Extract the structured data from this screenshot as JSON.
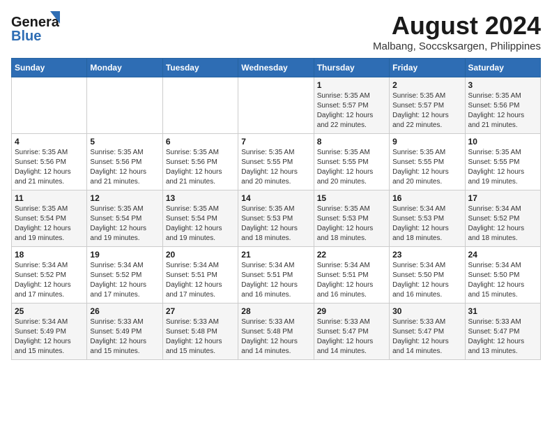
{
  "logo": {
    "line1": "General",
    "line2": "Blue"
  },
  "title": "August 2024",
  "location": "Malbang, Soccsksargen, Philippines",
  "weekdays": [
    "Sunday",
    "Monday",
    "Tuesday",
    "Wednesday",
    "Thursday",
    "Friday",
    "Saturday"
  ],
  "weeks": [
    [
      {
        "day": "",
        "info": ""
      },
      {
        "day": "",
        "info": ""
      },
      {
        "day": "",
        "info": ""
      },
      {
        "day": "",
        "info": ""
      },
      {
        "day": "1",
        "info": "Sunrise: 5:35 AM\nSunset: 5:57 PM\nDaylight: 12 hours\nand 22 minutes."
      },
      {
        "day": "2",
        "info": "Sunrise: 5:35 AM\nSunset: 5:57 PM\nDaylight: 12 hours\nand 22 minutes."
      },
      {
        "day": "3",
        "info": "Sunrise: 5:35 AM\nSunset: 5:56 PM\nDaylight: 12 hours\nand 21 minutes."
      }
    ],
    [
      {
        "day": "4",
        "info": "Sunrise: 5:35 AM\nSunset: 5:56 PM\nDaylight: 12 hours\nand 21 minutes."
      },
      {
        "day": "5",
        "info": "Sunrise: 5:35 AM\nSunset: 5:56 PM\nDaylight: 12 hours\nand 21 minutes."
      },
      {
        "day": "6",
        "info": "Sunrise: 5:35 AM\nSunset: 5:56 PM\nDaylight: 12 hours\nand 21 minutes."
      },
      {
        "day": "7",
        "info": "Sunrise: 5:35 AM\nSunset: 5:55 PM\nDaylight: 12 hours\nand 20 minutes."
      },
      {
        "day": "8",
        "info": "Sunrise: 5:35 AM\nSunset: 5:55 PM\nDaylight: 12 hours\nand 20 minutes."
      },
      {
        "day": "9",
        "info": "Sunrise: 5:35 AM\nSunset: 5:55 PM\nDaylight: 12 hours\nand 20 minutes."
      },
      {
        "day": "10",
        "info": "Sunrise: 5:35 AM\nSunset: 5:55 PM\nDaylight: 12 hours\nand 19 minutes."
      }
    ],
    [
      {
        "day": "11",
        "info": "Sunrise: 5:35 AM\nSunset: 5:54 PM\nDaylight: 12 hours\nand 19 minutes."
      },
      {
        "day": "12",
        "info": "Sunrise: 5:35 AM\nSunset: 5:54 PM\nDaylight: 12 hours\nand 19 minutes."
      },
      {
        "day": "13",
        "info": "Sunrise: 5:35 AM\nSunset: 5:54 PM\nDaylight: 12 hours\nand 19 minutes."
      },
      {
        "day": "14",
        "info": "Sunrise: 5:35 AM\nSunset: 5:53 PM\nDaylight: 12 hours\nand 18 minutes."
      },
      {
        "day": "15",
        "info": "Sunrise: 5:35 AM\nSunset: 5:53 PM\nDaylight: 12 hours\nand 18 minutes."
      },
      {
        "day": "16",
        "info": "Sunrise: 5:34 AM\nSunset: 5:53 PM\nDaylight: 12 hours\nand 18 minutes."
      },
      {
        "day": "17",
        "info": "Sunrise: 5:34 AM\nSunset: 5:52 PM\nDaylight: 12 hours\nand 18 minutes."
      }
    ],
    [
      {
        "day": "18",
        "info": "Sunrise: 5:34 AM\nSunset: 5:52 PM\nDaylight: 12 hours\nand 17 minutes."
      },
      {
        "day": "19",
        "info": "Sunrise: 5:34 AM\nSunset: 5:52 PM\nDaylight: 12 hours\nand 17 minutes."
      },
      {
        "day": "20",
        "info": "Sunrise: 5:34 AM\nSunset: 5:51 PM\nDaylight: 12 hours\nand 17 minutes."
      },
      {
        "day": "21",
        "info": "Sunrise: 5:34 AM\nSunset: 5:51 PM\nDaylight: 12 hours\nand 16 minutes."
      },
      {
        "day": "22",
        "info": "Sunrise: 5:34 AM\nSunset: 5:51 PM\nDaylight: 12 hours\nand 16 minutes."
      },
      {
        "day": "23",
        "info": "Sunrise: 5:34 AM\nSunset: 5:50 PM\nDaylight: 12 hours\nand 16 minutes."
      },
      {
        "day": "24",
        "info": "Sunrise: 5:34 AM\nSunset: 5:50 PM\nDaylight: 12 hours\nand 15 minutes."
      }
    ],
    [
      {
        "day": "25",
        "info": "Sunrise: 5:34 AM\nSunset: 5:49 PM\nDaylight: 12 hours\nand 15 minutes."
      },
      {
        "day": "26",
        "info": "Sunrise: 5:33 AM\nSunset: 5:49 PM\nDaylight: 12 hours\nand 15 minutes."
      },
      {
        "day": "27",
        "info": "Sunrise: 5:33 AM\nSunset: 5:48 PM\nDaylight: 12 hours\nand 15 minutes."
      },
      {
        "day": "28",
        "info": "Sunrise: 5:33 AM\nSunset: 5:48 PM\nDaylight: 12 hours\nand 14 minutes."
      },
      {
        "day": "29",
        "info": "Sunrise: 5:33 AM\nSunset: 5:47 PM\nDaylight: 12 hours\nand 14 minutes."
      },
      {
        "day": "30",
        "info": "Sunrise: 5:33 AM\nSunset: 5:47 PM\nDaylight: 12 hours\nand 14 minutes."
      },
      {
        "day": "31",
        "info": "Sunrise: 5:33 AM\nSunset: 5:47 PM\nDaylight: 12 hours\nand 13 minutes."
      }
    ]
  ]
}
